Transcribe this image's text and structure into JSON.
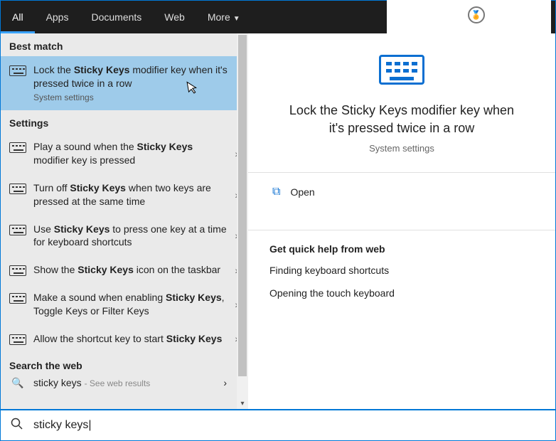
{
  "topbar": {
    "tabs": [
      "All",
      "Apps",
      "Documents",
      "Web",
      "More"
    ],
    "active_tab": 0,
    "zero": "0"
  },
  "left": {
    "best_match_header": "Best match",
    "best_match": {
      "title_html": "Lock the <b>Sticky Keys</b> modifier key when it's pressed twice in a row",
      "subtitle": "System settings"
    },
    "settings_header": "Settings",
    "settings": [
      {
        "title_html": "Play a sound when the <b>Sticky Keys</b> modifier key is pressed"
      },
      {
        "title_html": "Turn off <b>Sticky Keys</b> when two keys are pressed at the same time"
      },
      {
        "title_html": "Use <b>Sticky Keys</b> to press one key at a time for keyboard shortcuts"
      },
      {
        "title_html": "Show the <b>Sticky Keys</b> icon on the taskbar"
      },
      {
        "title_html": "Make a sound when enabling <b>Sticky Keys</b>, Toggle Keys or Filter Keys"
      },
      {
        "title_html": "Allow the shortcut key to start <b>Sticky Keys</b>"
      }
    ],
    "web_header": "Search the web",
    "web_row": {
      "text": "sticky keys",
      "faded": "- See web results"
    }
  },
  "right": {
    "title": "Lock the Sticky Keys modifier key when it's pressed twice in a row",
    "subtitle": "System settings",
    "open_label": "Open",
    "help_header": "Get quick help from web",
    "help_links": [
      "Finding keyboard shortcuts",
      "Opening the touch keyboard"
    ]
  },
  "search": {
    "query": "sticky keys"
  }
}
